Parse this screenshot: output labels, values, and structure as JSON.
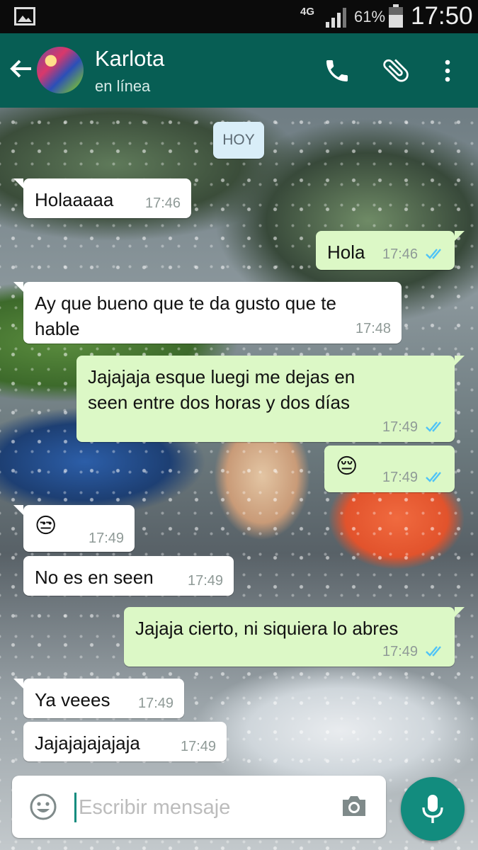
{
  "status_bar": {
    "network": "4G",
    "battery_pct": "61%",
    "time": "17:50",
    "icons": [
      "gallery-icon",
      "signal-icon",
      "battery-icon"
    ]
  },
  "header": {
    "contact_name": "Karlota",
    "contact_status": "en línea",
    "icons": [
      "back-arrow-icon",
      "phone-icon",
      "paperclip-icon",
      "more-vert-icon"
    ]
  },
  "chat": {
    "date_chip": "HOY",
    "messages": [
      {
        "dir": "in",
        "text": "Holaaaaa",
        "time": "17:46"
      },
      {
        "dir": "out",
        "text": "Hola",
        "time": "17:46",
        "status": "read"
      },
      {
        "dir": "in",
        "text": "Ay que bueno que te da gusto que te\nhable",
        "time": "17:48"
      },
      {
        "dir": "out",
        "text": "Jajajaja esque luegi me dejas en\nseen entre dos horas y dos días",
        "time": "17:49",
        "status": "read"
      },
      {
        "dir": "out",
        "text": "😔",
        "time": "17:49",
        "status": "read"
      },
      {
        "dir": "in",
        "text": "😒",
        "time": "17:49"
      },
      {
        "dir": "in",
        "text": "No es en seen",
        "time": "17:49"
      },
      {
        "dir": "out",
        "text": "Jajaja cierto, ni siquiera lo abres",
        "time": "17:49",
        "status": "read"
      },
      {
        "dir": "in",
        "text": "Ya veees",
        "time": "17:49"
      },
      {
        "dir": "in",
        "text": "Jajajajajajaja",
        "time": "17:49"
      }
    ]
  },
  "composer": {
    "placeholder": "Escribir mensaje",
    "icons": [
      "emoji-icon",
      "camera-icon",
      "microphone-icon"
    ]
  },
  "colors": {
    "header": "#075e54",
    "outgoing_bubble": "#dcf8c6",
    "incoming_bubble": "#ffffff",
    "accent": "#128c7e",
    "read_tick": "#4fc3f7"
  }
}
